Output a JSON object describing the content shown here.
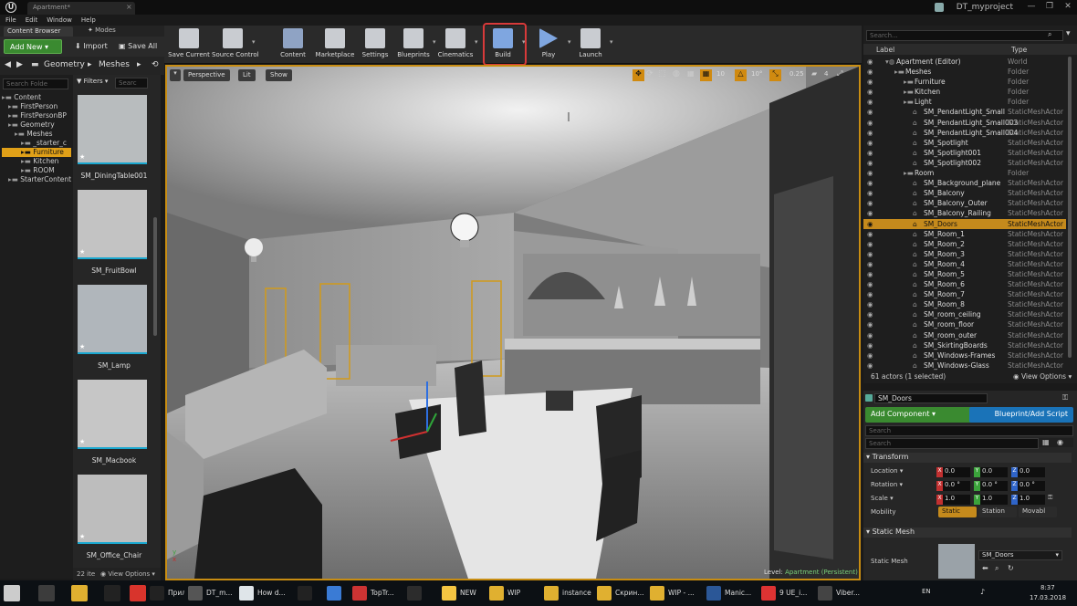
{
  "window": {
    "tab_title": "Apartment*",
    "project_name": "DT_myproject"
  },
  "menu": [
    "File",
    "Edit",
    "Window",
    "Help"
  ],
  "content_browser": {
    "tab_label": "Content Browser",
    "modes_label": "Modes",
    "add_new_label": "Add New",
    "import_label": "Import",
    "save_all_label": "Save All",
    "path": [
      "Geometry",
      "Meshes"
    ],
    "folder_search_placeholder": "Search Folde",
    "filters_label": "Filters",
    "asset_search_placeholder": "Searc",
    "tree": [
      {
        "label": "Content",
        "level": 0
      },
      {
        "label": "FirstPerson",
        "level": 1
      },
      {
        "label": "FirstPersonBP",
        "level": 1
      },
      {
        "label": "Geometry",
        "level": 1
      },
      {
        "label": "Meshes",
        "level": 2
      },
      {
        "label": "_starter_c",
        "level": 3
      },
      {
        "label": "Furniture",
        "level": 3,
        "selected": true
      },
      {
        "label": "Kitchen",
        "level": 3
      },
      {
        "label": "ROOM",
        "level": 3
      },
      {
        "label": "StarterContent",
        "level": 1
      }
    ],
    "assets": [
      "SM_DiningTable001",
      "SM_FruitBowl",
      "SM_Lamp",
      "SM_Macbook",
      "SM_Office_Chair"
    ],
    "item_count": "22 ite",
    "view_options_label": "View Options"
  },
  "toolbar": {
    "buttons": [
      "Save Current",
      "Source Control",
      "Content",
      "Marketplace",
      "Settings",
      "Blueprints",
      "Cinematics",
      "Build",
      "Play",
      "Launch"
    ],
    "highlighted": "Build"
  },
  "viewport": {
    "perspective_label": "Perspective",
    "lit_label": "Lit",
    "show_label": "Show",
    "grid_snap": "10",
    "rotation_snap": "10°",
    "scale_snap": "0.25",
    "camera_speed": "4",
    "level_label": "Level:",
    "level_name": "Apartment (Persistent)"
  },
  "outliner": {
    "search_placeholder": "Search...",
    "col_label": "Label",
    "col_type": "Type",
    "rows": [
      {
        "name": "Apartment (Editor)",
        "type": "World",
        "indent": 0
      },
      {
        "name": "Meshes",
        "type": "Folder",
        "indent": 1
      },
      {
        "name": "Furniture",
        "type": "Folder",
        "indent": 2
      },
      {
        "name": "Kitchen",
        "type": "Folder",
        "indent": 2
      },
      {
        "name": "Light",
        "type": "Folder",
        "indent": 2
      },
      {
        "name": "SM_PendantLight_Small",
        "type": "StaticMeshActor",
        "indent": 3
      },
      {
        "name": "SM_PendantLight_Small003",
        "type": "StaticMeshActor",
        "indent": 3
      },
      {
        "name": "SM_PendantLight_Small004",
        "type": "StaticMeshActor",
        "indent": 3
      },
      {
        "name": "SM_Spotlight",
        "type": "StaticMeshActor",
        "indent": 3
      },
      {
        "name": "SM_Spotlight001",
        "type": "StaticMeshActor",
        "indent": 3
      },
      {
        "name": "SM_Spotlight002",
        "type": "StaticMeshActor",
        "indent": 3
      },
      {
        "name": "Room",
        "type": "Folder",
        "indent": 2
      },
      {
        "name": "SM_Background_plane",
        "type": "StaticMeshActor",
        "indent": 3
      },
      {
        "name": "SM_Balcony",
        "type": "StaticMeshActor",
        "indent": 3
      },
      {
        "name": "SM_Balcony_Outer",
        "type": "StaticMeshActor",
        "indent": 3
      },
      {
        "name": "SM_Balcony_Railing",
        "type": "StaticMeshActor",
        "indent": 3
      },
      {
        "name": "SM_Doors",
        "type": "StaticMeshActor",
        "indent": 3,
        "selected": true
      },
      {
        "name": "SM_Room_1",
        "type": "StaticMeshActor",
        "indent": 3
      },
      {
        "name": "SM_Room_2",
        "type": "StaticMeshActor",
        "indent": 3
      },
      {
        "name": "SM_Room_3",
        "type": "StaticMeshActor",
        "indent": 3
      },
      {
        "name": "SM_Room_4",
        "type": "StaticMeshActor",
        "indent": 3
      },
      {
        "name": "SM_Room_5",
        "type": "StaticMeshActor",
        "indent": 3
      },
      {
        "name": "SM_Room_6",
        "type": "StaticMeshActor",
        "indent": 3
      },
      {
        "name": "SM_Room_7",
        "type": "StaticMeshActor",
        "indent": 3
      },
      {
        "name": "SM_Room_8",
        "type": "StaticMeshActor",
        "indent": 3
      },
      {
        "name": "SM_room_ceiling",
        "type": "StaticMeshActor",
        "indent": 3
      },
      {
        "name": "SM_room_floor",
        "type": "StaticMeshActor",
        "indent": 3
      },
      {
        "name": "SM_room_outer",
        "type": "StaticMeshActor",
        "indent": 3
      },
      {
        "name": "SM_SkirtingBoards",
        "type": "StaticMeshActor",
        "indent": 3
      },
      {
        "name": "SM_Windows-Frames",
        "type": "StaticMeshActor",
        "indent": 3
      },
      {
        "name": "SM_Windows-Glass",
        "type": "StaticMeshActor",
        "indent": 3
      }
    ],
    "actor_count": "61 actors (1 selected)",
    "view_options_label": "View Options"
  },
  "details": {
    "actor_name": "SM_Doors",
    "add_component_label": "Add Component",
    "blueprint_label": "Blueprint/Add Script",
    "search_placeholder": "Search",
    "search2_placeholder": "Search",
    "transform_label": "Transform",
    "location_label": "Location",
    "rotation_label": "Rotation",
    "scale_label": "Scale",
    "mobility_label": "Mobility",
    "location": [
      "0.0",
      "0.0",
      "0.0"
    ],
    "rotation": [
      "0.0 °",
      "0.0 °",
      "0.0 °"
    ],
    "scale": [
      "1.0",
      "1.0",
      "1.0"
    ],
    "mobility_options": [
      "Static",
      "Station",
      "Movabl"
    ],
    "static_mesh_section": "Static Mesh",
    "static_mesh_label": "Static Mesh",
    "static_mesh_value": "SM_Doors"
  },
  "taskbar": {
    "items": [
      "Прило...",
      "DT_m...",
      "How d...",
      "",
      "",
      "TopTr...",
      "",
      "NEW",
      "WIP",
      "instance",
      "Скрин...",
      "WIP - ...",
      "Manic...",
      "9 UE_i...",
      "Viber..."
    ],
    "lang": "EN",
    "time": "8:37",
    "date": "17.03.2018"
  },
  "colors": {
    "accent": "#e0a018",
    "add_new": "#3a8a30",
    "add_component": "#3a8a30",
    "blueprint": "#1a73b8",
    "build_highlight": "#d83a3a",
    "selection": "#c58a1c"
  }
}
